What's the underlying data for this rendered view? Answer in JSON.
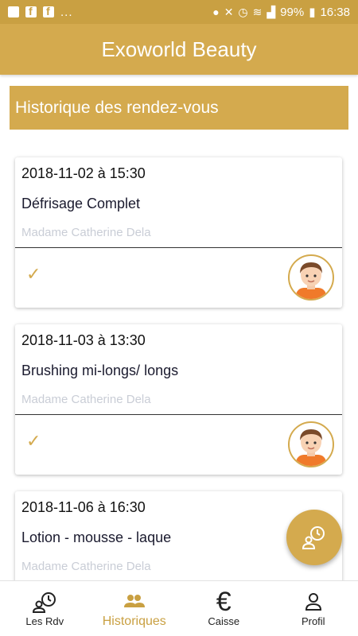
{
  "status_bar": {
    "dots": "...",
    "battery": "99%",
    "time": "16:38"
  },
  "app": {
    "title": "Exoworld Beauty"
  },
  "section": {
    "title": "Historique des rendez-vous"
  },
  "appointments": [
    {
      "date": "2018-11-02 à 15:30",
      "service": "Défrisage Complet",
      "client": "Madame Catherine Dela",
      "status": "done"
    },
    {
      "date": "2018-11-03 à 13:30",
      "service": "Brushing mi-longs/ longs",
      "client": "Madame Catherine Dela",
      "status": "done"
    },
    {
      "date": "2018-11-06 à 16:30",
      "service": "Lotion - mousse - laque",
      "client": "Madame Catherine Dela",
      "status": "done"
    }
  ],
  "bottom_nav": {
    "items": [
      {
        "label": "Les Rdv",
        "icon": "calendar-clock-icon"
      },
      {
        "label": "Historiques",
        "icon": "people-icon"
      },
      {
        "label": "Caisse",
        "icon": "euro-icon"
      },
      {
        "label": "Profil",
        "icon": "person-icon"
      }
    ],
    "active": "Historiques"
  },
  "colors": {
    "accent": "#d4aa4e",
    "statusbar": "#c9a042",
    "check": "#d4aa4e"
  },
  "fab": {
    "icon": "person-clock-icon"
  }
}
